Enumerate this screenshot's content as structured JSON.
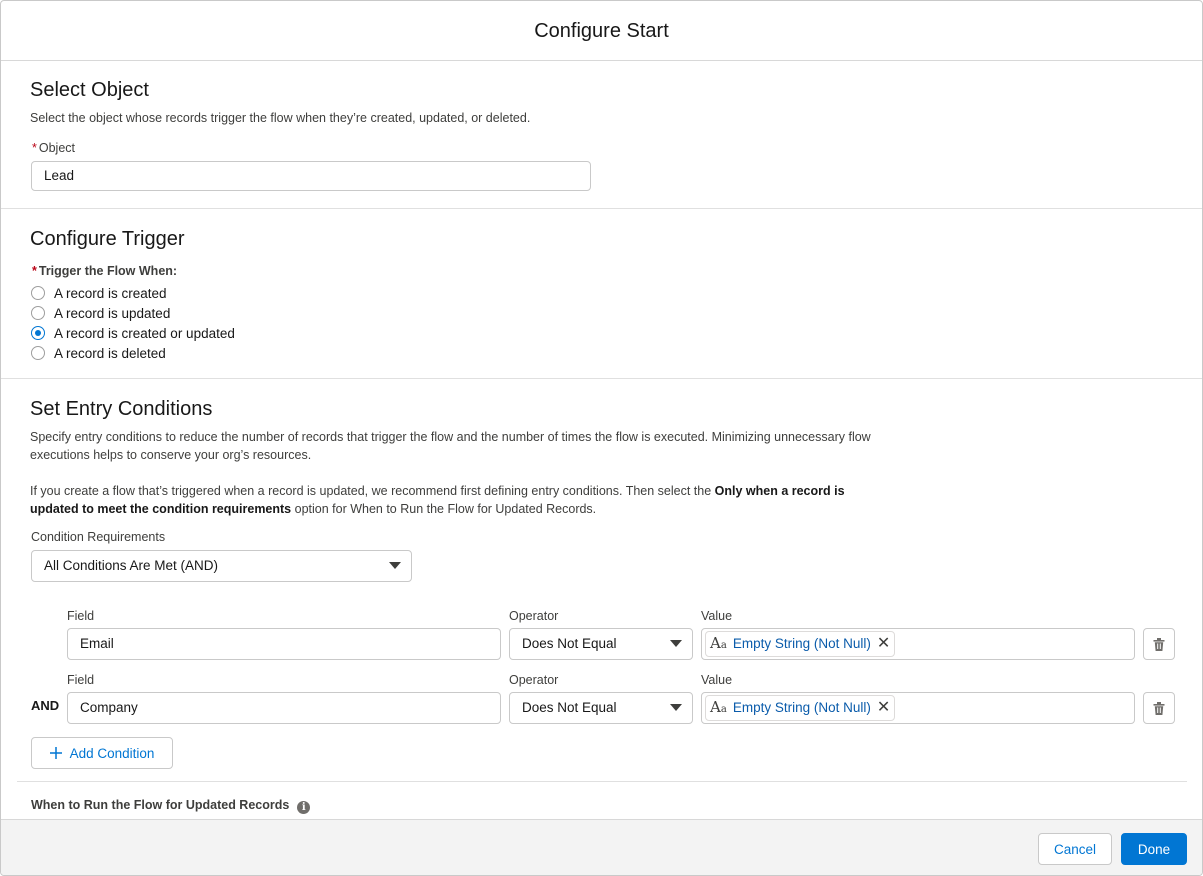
{
  "modal": {
    "title": "Configure Start"
  },
  "select_object": {
    "title": "Select Object",
    "description": "Select the object whose records trigger the flow when they’re created, updated, or deleted.",
    "object_label": "Object",
    "required_marker": "*",
    "object_value": "Lead"
  },
  "configure_trigger": {
    "title": "Configure Trigger",
    "required_marker": "*",
    "label": "Trigger the Flow When:",
    "options": [
      {
        "label": "A record is created",
        "checked": false
      },
      {
        "label": "A record is updated",
        "checked": false
      },
      {
        "label": "A record is created or updated",
        "checked": true
      },
      {
        "label": "A record is deleted",
        "checked": false
      }
    ]
  },
  "entry_conditions": {
    "title": "Set Entry Conditions",
    "description": "Specify entry conditions to reduce the number of records that trigger the flow and the number of times the flow is executed. Minimizing unnecessary flow executions helps to conserve your org’s resources.",
    "recommendation_prefix": "If you create a flow that’s triggered when a record is updated, we recommend first defining entry conditions. Then select the ",
    "recommendation_bold": "Only when a record is updated to meet the condition requirements",
    "recommendation_suffix": " option for When to Run the Flow for Updated Records.",
    "requirements_label": "Condition Requirements",
    "requirements_value": "All Conditions Are Met (AND)",
    "conditions": [
      {
        "prefix": "",
        "field_label": "Field",
        "field": "Email",
        "operator_label": "Operator",
        "operator": "Does Not Equal",
        "value_label": "Value",
        "value": "Empty String (Not Null)"
      },
      {
        "prefix": "AND",
        "field_label": "Field",
        "field": "Company",
        "operator_label": "Operator",
        "operator": "Does Not Equal",
        "value_label": "Value",
        "value": "Empty String (Not Null)"
      }
    ],
    "add_condition_label": "Add Condition",
    "when_to_run_label": "When to Run the Flow for Updated Records"
  },
  "footer": {
    "cancel_label": "Cancel",
    "done_label": "Done"
  },
  "colors": {
    "brand": "#0176d3",
    "link": "#0b5cab",
    "required": "#ba0517",
    "footer_bg": "#f3f3f3"
  },
  "icons": [
    "text-type-icon",
    "close-icon",
    "trash-icon",
    "add-icon",
    "info-icon",
    "chevron-down-icon"
  ]
}
